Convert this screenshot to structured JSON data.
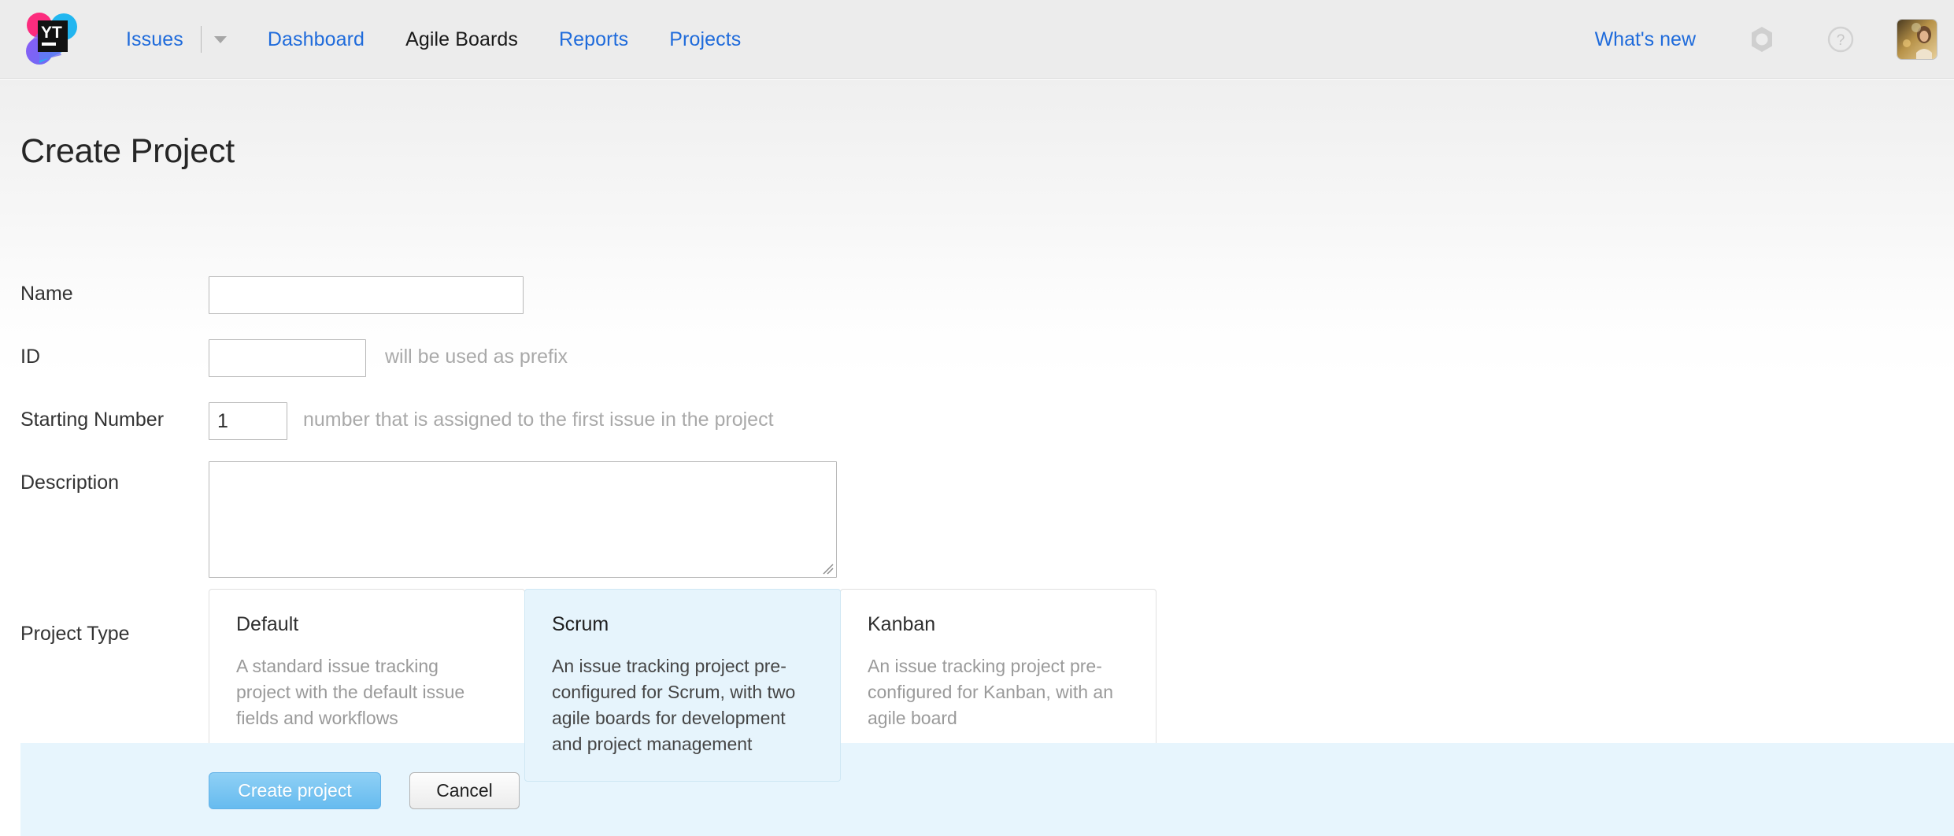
{
  "header": {
    "logo_alt": "YouTrack",
    "logo_text": "YT",
    "nav": [
      {
        "label": "Issues",
        "active": false
      },
      {
        "label": "Dashboard",
        "active": false
      },
      {
        "label": "Agile Boards",
        "active": true
      },
      {
        "label": "Reports",
        "active": false
      },
      {
        "label": "Projects",
        "active": false
      }
    ],
    "whats_new": "What's new",
    "settings_icon": "gear-icon",
    "help_icon": "help-circle-icon",
    "avatar_icon": "user-avatar",
    "dropdown_icon": "chevron-down-icon"
  },
  "page": {
    "title": "Create Project"
  },
  "form": {
    "name": {
      "label": "Name",
      "value": "",
      "placeholder": ""
    },
    "id": {
      "label": "ID",
      "value": "",
      "placeholder": "",
      "hint": "will be used as prefix"
    },
    "starting_number": {
      "label": "Starting Number",
      "value": "1",
      "placeholder": "",
      "hint": "number that is assigned to the first issue in the project"
    },
    "description": {
      "label": "Description",
      "value": "",
      "placeholder": ""
    },
    "project_type": {
      "label": "Project Type",
      "selected": "Scrum",
      "options": [
        {
          "title": "Default",
          "description": "A standard issue tracking project with the default issue fields and workflows",
          "selected": false
        },
        {
          "title": "Scrum",
          "description": "An issue tracking project pre-configured for Scrum, with two agile boards for development and project management",
          "selected": true
        },
        {
          "title": "Kanban",
          "description": "An issue tracking project pre-configured for Kanban, with an agile board",
          "selected": false
        }
      ]
    }
  },
  "footer": {
    "create_label": "Create project",
    "cancel_label": "Cancel"
  },
  "colors": {
    "link": "#1f6bdb",
    "header_bg": "#ececec",
    "selected_card_bg": "#e6f4fc",
    "footer_bg": "#e7f5fd",
    "primary_button": "#66bbef"
  }
}
